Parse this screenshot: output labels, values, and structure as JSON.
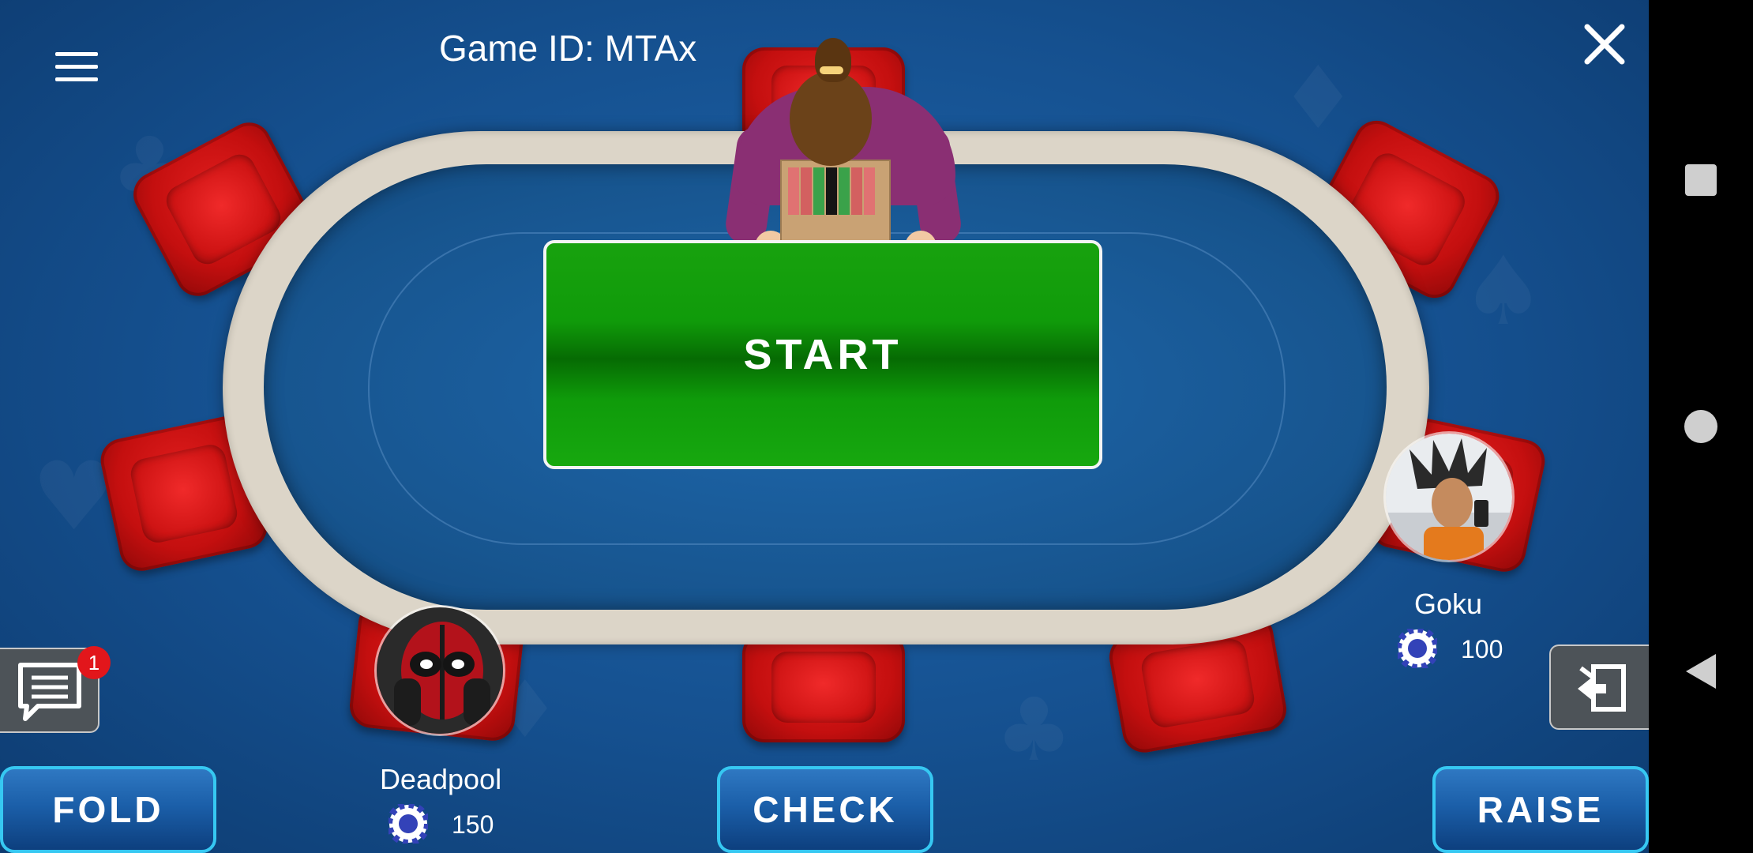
{
  "header": {
    "game_id": "Game ID: MTAx"
  },
  "table": {
    "start_label": "START"
  },
  "players": [
    {
      "name": "Deadpool",
      "chips": "150"
    },
    {
      "name": "Goku",
      "chips": "100"
    }
  ],
  "chat": {
    "unread_count": "1"
  },
  "actions": {
    "fold_label": "FOLD",
    "check_label": "CHECK",
    "raise_label": "RAISE"
  },
  "icons": {
    "menu": "hamburger-icon",
    "close": "close-icon",
    "chat": "chat-icon",
    "side": "exit-seat-icon",
    "chip": "chip-icon"
  },
  "colors": {
    "felt": "#17558f",
    "start": "#109b0a",
    "chair": "#c40f0f",
    "action_border": "#36c8f2",
    "badge": "#e2161b"
  }
}
